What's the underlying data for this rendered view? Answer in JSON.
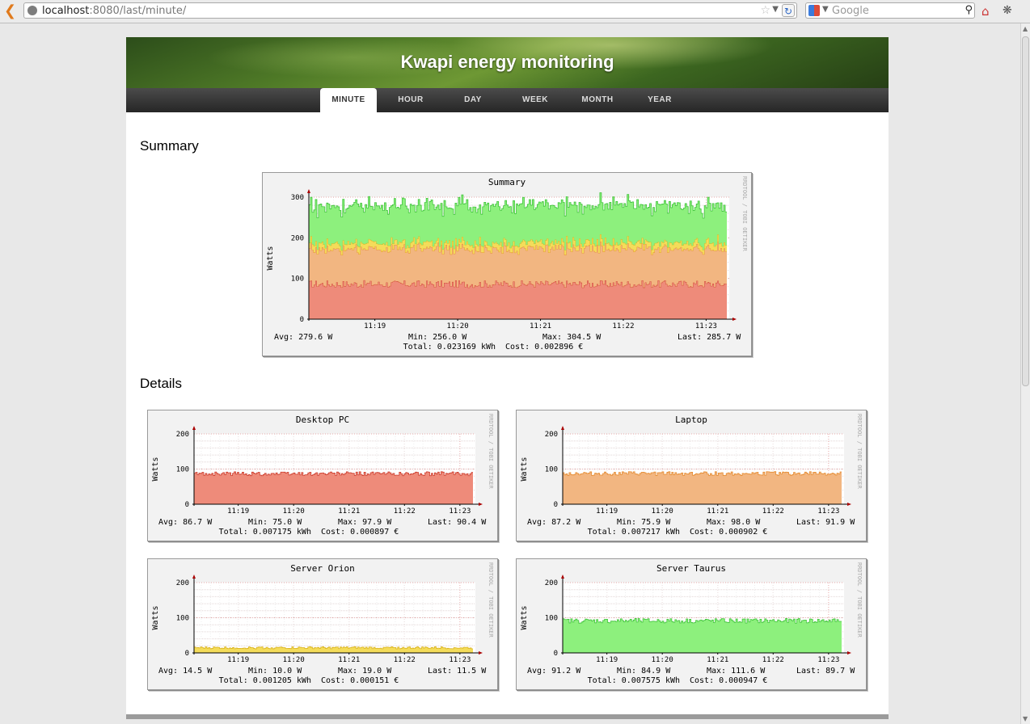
{
  "browser": {
    "url_host": "localhost",
    "url_rest": ":8080/last/minute/",
    "search_placeholder": "Google"
  },
  "header": {
    "title": "Kwapi energy monitoring"
  },
  "nav": {
    "tabs": [
      {
        "label": "MINUTE",
        "active": true
      },
      {
        "label": "HOUR"
      },
      {
        "label": "DAY"
      },
      {
        "label": "WEEK"
      },
      {
        "label": "MONTH"
      },
      {
        "label": "YEAR"
      }
    ]
  },
  "sections": {
    "summary": "Summary",
    "details": "Details"
  },
  "chart_data": [
    {
      "type": "area",
      "title": "Summary",
      "ylabel": "Watts",
      "ylim": [
        0,
        300
      ],
      "yticks": [
        "0",
        "100",
        "200",
        "300"
      ],
      "xticks": [
        "11:19",
        "11:20",
        "11:21",
        "11:22",
        "11:23"
      ],
      "watermark": "RRDTOOL / TOBI OETIKER",
      "stacked": true,
      "series": [
        {
          "values_mean": 86.7,
          "color": "#ee8b7a",
          "line": "#cc3a2a"
        },
        {
          "values_mean": 87.2,
          "color": "#f2b681",
          "line": "#e58a2e"
        },
        {
          "values_mean": 14.5,
          "color": "#f4dc5a",
          "line": "#d9b21a"
        },
        {
          "values_mean": 91.2,
          "color": "#8df07d",
          "line": "#3fc33a"
        }
      ],
      "stats": {
        "avg": "Avg: 279.6 W",
        "min": "Min: 256.0 W",
        "max": "Max: 304.5 W",
        "last": "Last: 285.7 W",
        "total": "Total: 0.023169 kWh",
        "cost": "Cost: 0.002896 €"
      }
    },
    {
      "type": "area",
      "title": "Desktop PC",
      "ylabel": "Watts",
      "ylim": [
        0,
        200
      ],
      "yticks": [
        "0",
        "100",
        "200"
      ],
      "xticks": [
        "11:19",
        "11:20",
        "11:21",
        "11:22",
        "11:23"
      ],
      "watermark": "RRDTOOL / TOBI OETIKER",
      "series": [
        {
          "values_mean": 86.7,
          "min": 75.0,
          "max": 97.9,
          "last": 90.4,
          "color": "#ee8b7a",
          "line": "#cc3a2a"
        }
      ],
      "stats": {
        "avg": "Avg: 86.7 W",
        "min": "Min: 75.0 W",
        "max": "Max: 97.9 W",
        "last": "Last: 90.4 W",
        "total": "Total: 0.007175 kWh",
        "cost": "Cost: 0.000897 €"
      }
    },
    {
      "type": "area",
      "title": "Laptop",
      "ylabel": "Watts",
      "ylim": [
        0,
        200
      ],
      "yticks": [
        "0",
        "100",
        "200"
      ],
      "xticks": [
        "11:19",
        "11:20",
        "11:21",
        "11:22",
        "11:23"
      ],
      "watermark": "RRDTOOL / TOBI OETIKER",
      "series": [
        {
          "values_mean": 87.2,
          "min": 75.9,
          "max": 98.0,
          "last": 91.9,
          "color": "#f2b681",
          "line": "#e58a2e"
        }
      ],
      "stats": {
        "avg": "Avg: 87.2 W",
        "min": "Min: 75.9 W",
        "max": "Max: 98.0 W",
        "last": "Last: 91.9 W",
        "total": "Total: 0.007217 kWh",
        "cost": "Cost: 0.000902 €"
      }
    },
    {
      "type": "area",
      "title": "Server Orion",
      "ylabel": "Watts",
      "ylim": [
        0,
        200
      ],
      "yticks": [
        "0",
        "100",
        "200"
      ],
      "xticks": [
        "11:19",
        "11:20",
        "11:21",
        "11:22",
        "11:23"
      ],
      "watermark": "RRDTOOL / TOBI OETIKER",
      "series": [
        {
          "values_mean": 14.5,
          "min": 10.0,
          "max": 19.0,
          "last": 11.5,
          "color": "#f4dc5a",
          "line": "#d9b21a"
        }
      ],
      "stats": {
        "avg": "Avg: 14.5 W",
        "min": "Min: 10.0 W",
        "max": "Max: 19.0 W",
        "last": "Last: 11.5 W",
        "total": "Total: 0.001205 kWh",
        "cost": "Cost: 0.000151 €"
      }
    },
    {
      "type": "area",
      "title": "Server Taurus",
      "ylabel": "Watts",
      "ylim": [
        0,
        200
      ],
      "yticks": [
        "0",
        "100",
        "200"
      ],
      "xticks": [
        "11:19",
        "11:20",
        "11:21",
        "11:22",
        "11:23"
      ],
      "watermark": "RRDTOOL / TOBI OETIKER",
      "series": [
        {
          "values_mean": 91.2,
          "min": 84.9,
          "max": 111.6,
          "last": 89.7,
          "color": "#8df07d",
          "line": "#3fc33a"
        }
      ],
      "stats": {
        "avg": "Avg: 91.2 W",
        "min": "Min: 84.9 W",
        "max": "Max: 111.6 W",
        "last": "Last: 89.7 W",
        "total": "Total: 0.007575 kWh",
        "cost": "Cost: 0.000947 €"
      }
    }
  ]
}
